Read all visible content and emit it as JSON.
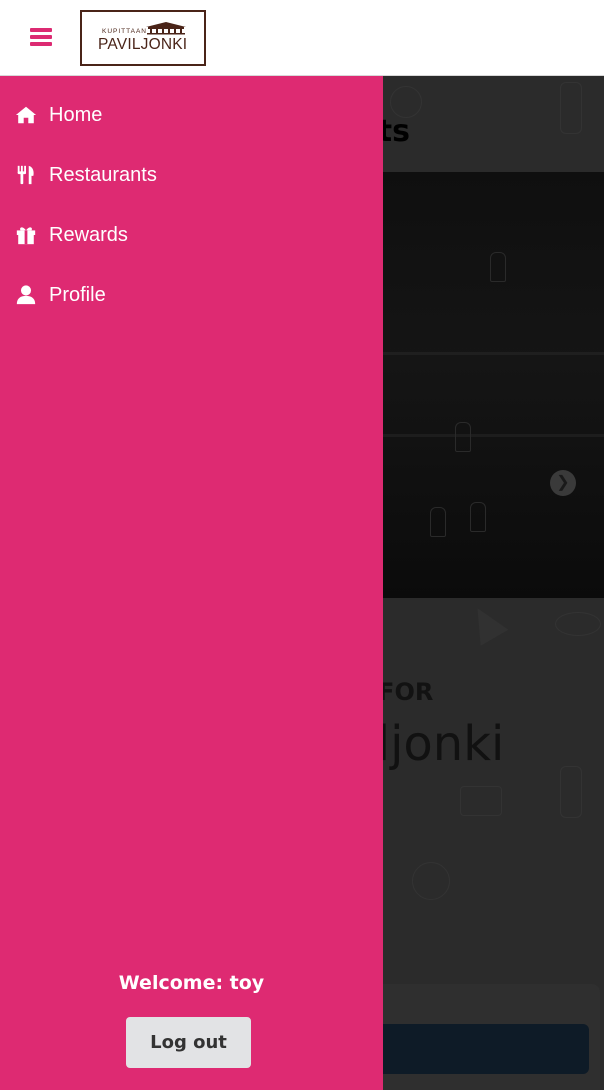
{
  "header": {
    "menu_icon": "hamburger-icon",
    "logo_small": "KUPITTAAN",
    "logo_big": "PAVILJONKI"
  },
  "drawer": {
    "items": [
      {
        "label": "Home",
        "icon": "home-icon"
      },
      {
        "label": "Restaurants",
        "icon": "utensils-icon"
      },
      {
        "label": "Rewards",
        "icon": "gift-icon"
      },
      {
        "label": "Profile",
        "icon": "user-icon"
      }
    ],
    "welcome": "Welcome: toy",
    "logout_label": "Log out"
  },
  "background_page": {
    "title_partial": "urants",
    "looking_partial": "G FOR",
    "brand_partial": "viljonki",
    "next_icon": "chevron-right-icon"
  },
  "colors": {
    "accent": "#de2a72",
    "logo_brown": "#4a2418",
    "overlay": "#2b2b2b"
  }
}
